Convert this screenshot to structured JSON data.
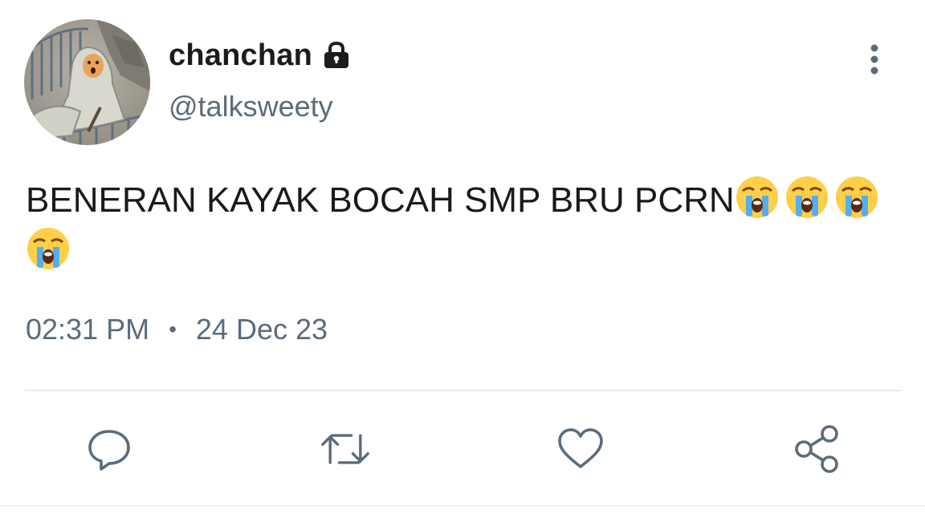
{
  "user": {
    "display_name": "chanchan",
    "handle": "@talksweety",
    "protected": true
  },
  "tweet": {
    "text": "BENERAN KAYAK BOCAH SMP BRU PCRN",
    "emoji_count": 4,
    "time": "02:31 PM",
    "separator": "•",
    "date": "24 Dec 23"
  },
  "actions": [
    "reply",
    "retweet",
    "like",
    "share"
  ],
  "colors": {
    "text": "#1a1a1a",
    "secondary": "#5b6b7b",
    "divider": "#e6e9ec"
  }
}
